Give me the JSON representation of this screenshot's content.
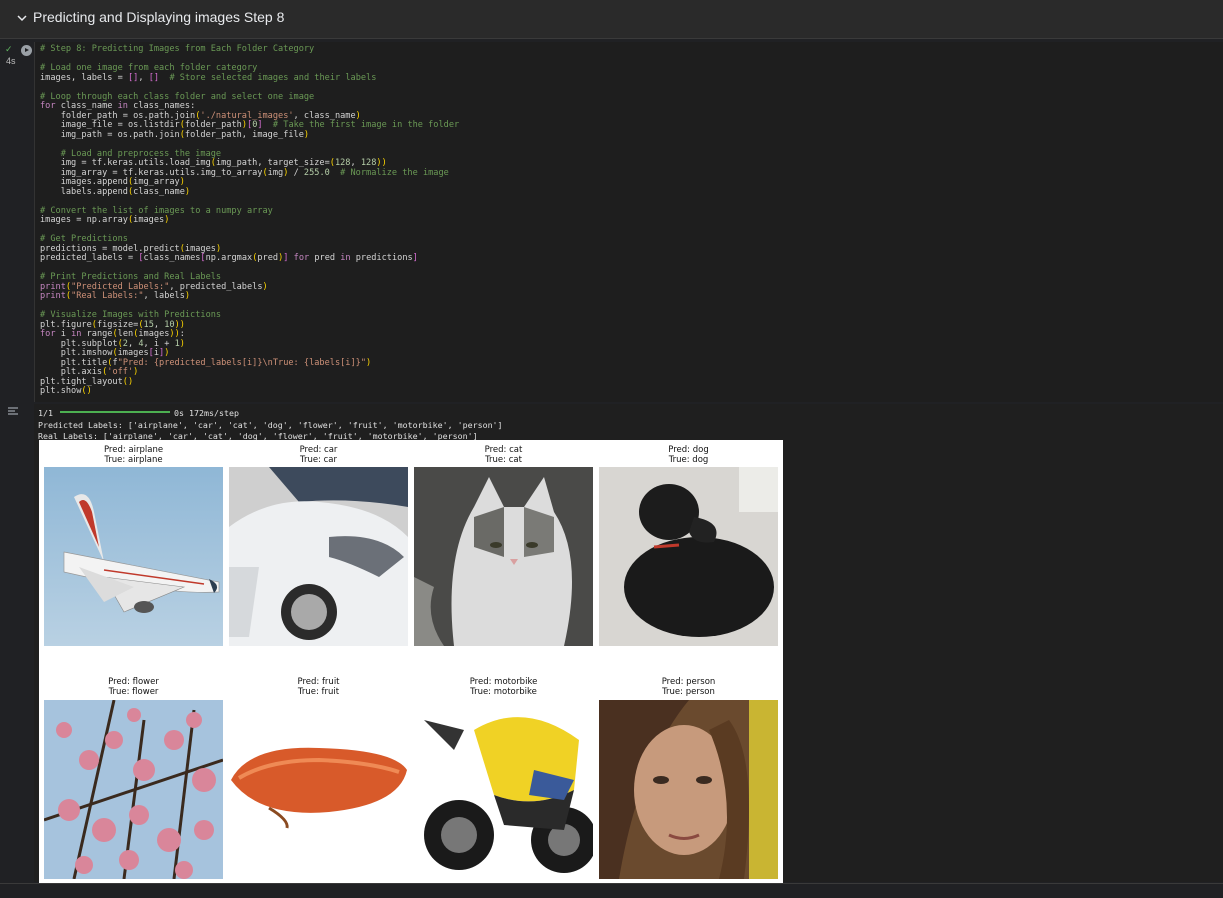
{
  "section": {
    "title": "Predicting and Displaying images Step 8"
  },
  "cell": {
    "exec_time": "4s",
    "status": "✓"
  },
  "code_lines": [
    "# Step 8: Predicting Images from Each Folder Category",
    "",
    "# Load one image from each folder category",
    "images, labels = [], []  # Store selected images and their labels",
    "",
    "# Loop through each class folder and select one image",
    "for class_name in class_names:",
    "    folder_path = os.path.join('./natural_images', class_name)",
    "    image_file = os.listdir(folder_path)[0]  # Take the first image in the folder",
    "    img_path = os.path.join(folder_path, image_file)",
    "",
    "    # Load and preprocess the image",
    "    img = tf.keras.utils.load_img(img_path, target_size=(128, 128))",
    "    img_array = tf.keras.utils.img_to_array(img) / 255.0  # Normalize the image",
    "    images.append(img_array)",
    "    labels.append(class_name)",
    "",
    "# Convert the list of images to a numpy array",
    "images = np.array(images)",
    "",
    "# Get Predictions",
    "predictions = model.predict(images)",
    "predicted_labels = [class_names[np.argmax(pred)] for pred in predictions]",
    "",
    "# Print Predictions and Real Labels",
    "print(\"Predicted Labels:\", predicted_labels)",
    "print(\"Real Labels:\", labels)",
    "",
    "# Visualize Images with Predictions",
    "plt.figure(figsize=(15, 10))",
    "for i in range(len(images)):",
    "    plt.subplot(2, 4, i + 1)",
    "    plt.imshow(images[i])",
    "    plt.title(f\"Pred: {predicted_labels[i]}\\nTrue: {labels[i]}\")",
    "    plt.axis('off')",
    "plt.tight_layout()",
    "plt.show()"
  ],
  "output": {
    "progress_label": "1/1",
    "progress_fraction": 1.0,
    "progress_time": "0s 172ms/step",
    "predicted_line": "Predicted Labels: ['airplane', 'car', 'cat', 'dog', 'flower', 'fruit', 'motorbike', 'person']",
    "real_line": "Real Labels: ['airplane', 'car', 'cat', 'dog', 'flower', 'fruit', 'motorbike', 'person']"
  },
  "figure": {
    "tiles": [
      {
        "pred": "Pred: airplane",
        "true": "True: airplane",
        "subject": "airplane"
      },
      {
        "pred": "Pred: car",
        "true": "True: car",
        "subject": "car"
      },
      {
        "pred": "Pred: cat",
        "true": "True: cat",
        "subject": "cat"
      },
      {
        "pred": "Pred: dog",
        "true": "True: dog",
        "subject": "dog"
      },
      {
        "pred": "Pred: flower",
        "true": "True: flower",
        "subject": "flower"
      },
      {
        "pred": "Pred: fruit",
        "true": "True: fruit",
        "subject": "fruit"
      },
      {
        "pred": "Pred: motorbike",
        "true": "True: motorbike",
        "subject": "motorbike"
      },
      {
        "pred": "Pred: person",
        "true": "True: person",
        "subject": "person"
      }
    ]
  },
  "colors": {
    "accent_progress": "#4caf50",
    "comment": "#6a9955",
    "keyword": "#c586c0",
    "string": "#ce9178"
  }
}
